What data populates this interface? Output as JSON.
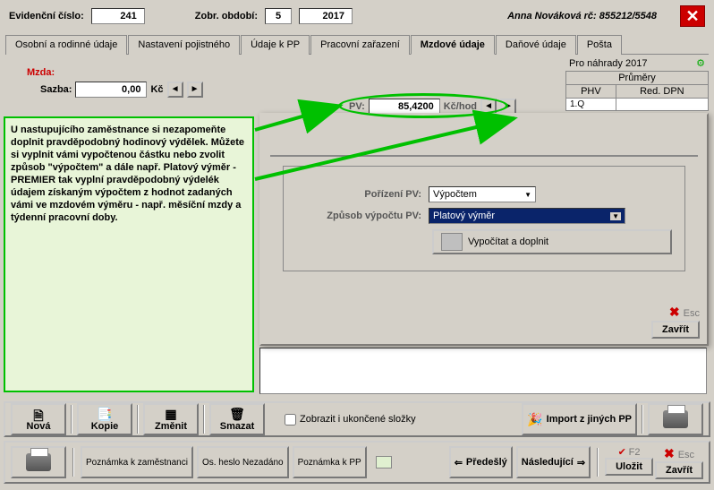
{
  "header": {
    "evid_label": "Evidenční číslo:",
    "evid_value": "241",
    "period_label": "Zobr. období:",
    "period_month": "5",
    "period_year": "2017",
    "person": "Anna Nováková rč: 855212/5548"
  },
  "tabs": [
    {
      "label": "Osobní a rodinné údaje"
    },
    {
      "label": "Nastavení pojistného"
    },
    {
      "label": "Údaje k PP"
    },
    {
      "label": "Pracovní zařazení"
    },
    {
      "label": "Mzdové údaje"
    },
    {
      "label": "Daňové údaje"
    },
    {
      "label": "Pošta"
    }
  ],
  "mzda": {
    "section_label": "Mzda:",
    "sazba_label": "Sazba:",
    "sazba_value": "0,00",
    "sazba_unit": "Kč"
  },
  "pv": {
    "label": "PV:",
    "value": "85,4200",
    "unit": "Kč/hod"
  },
  "averages": {
    "title": "Pro náhrady 2017",
    "col_header": "Průměry",
    "cols": [
      "PHV",
      "Red. DPN"
    ],
    "rowleft": "1.Q"
  },
  "hint": "U nastupujícího zaměstnance si nezapomeňte doplnit pravděpodobný hodinový výdělek. Můžete si vyplnit vámi vypočtenou částku nebo zvolit způsob \"výpočtem\" a dále např. Platový výměr - PREMIER tak vyplní pravděpodobný výdelék údajem získaným výpočtem z hodnot zadaných vámi ve mzdovém výměru - např. měsíční mzdy a týdenní pracovní doby.",
  "panel": {
    "pv_mode_label": "Pořízení PV:",
    "pv_mode_value": "Výpočtem",
    "calc_label": "Způsob výpočtu PV:",
    "calc_value": "Platový výměr",
    "calc_btn": "Vypočítat a doplnit",
    "close_shortcut": "Esc",
    "close_btn": "Zavřít"
  },
  "checkbox_label": "Zobrazit i ukončené složky",
  "toolbar1": {
    "nova": "Nová",
    "kopie": "Kopie",
    "zmenit": "Změnit",
    "smazat": "Smazat",
    "import": "Import z jiných PP"
  },
  "toolbar2": {
    "pozn_zam": "Poznámka k zaměstnanci",
    "heslo": "Os. heslo Nezadáno",
    "pozn_pp": "Poznámka k PP",
    "prev": "Předešlý",
    "next": "Následující",
    "save_hint": "F2",
    "save": "Uložit",
    "close_hint": "Esc",
    "close": "Zavřít"
  }
}
